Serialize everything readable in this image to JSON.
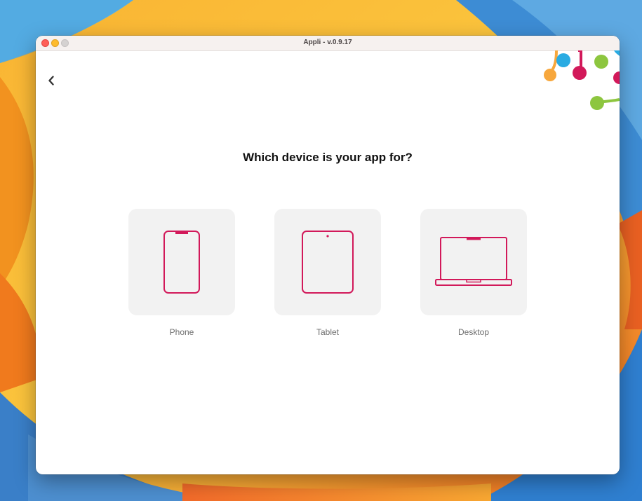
{
  "window": {
    "title": "Appli - v.0.9.17"
  },
  "page": {
    "back_icon": "chevron-left-icon",
    "heading": "Which device is your app for?"
  },
  "devices": [
    {
      "label": "Phone",
      "icon": "phone-icon"
    },
    {
      "label": "Tablet",
      "icon": "tablet-icon"
    },
    {
      "label": "Desktop",
      "icon": "laptop-icon"
    }
  ],
  "colors": {
    "accent": "#d2195a",
    "card_bg": "#f2f2f2",
    "logo_orange": "#f7a73c",
    "logo_blue": "#29abe2",
    "logo_green": "#8dc63f",
    "logo_magenta": "#d2195a"
  }
}
